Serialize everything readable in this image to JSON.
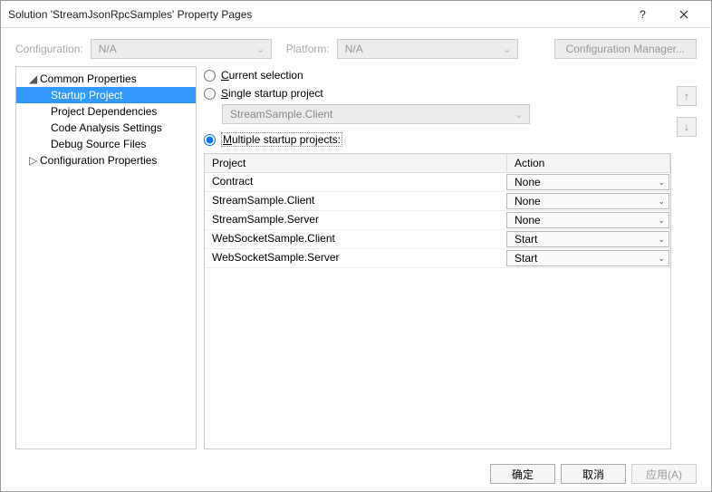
{
  "window": {
    "title": "Solution 'StreamJsonRpcSamples' Property Pages"
  },
  "configRow": {
    "configLabel_pre": "C",
    "configLabel_mid": "onfiguration:",
    "configValue": "N/A",
    "platformLabel_pre": "P",
    "platformLabel_mid": "latform:",
    "platformValue": "N/A",
    "managerLabel": "Configuration Manager..."
  },
  "tree": {
    "n0": "Common Properties",
    "n0_0": "Startup Project",
    "n0_1": "Project Dependencies",
    "n0_2": "Code Analysis Settings",
    "n0_3": "Debug Source Files",
    "n1": "Configuration Properties"
  },
  "radios": {
    "current_u": "C",
    "current_rest": "urrent selection",
    "single_u": "S",
    "single_rest": "ingle startup project",
    "singleValue": "StreamSample.Client",
    "multi_u": "M",
    "multi_rest": "ultiple startup projects:"
  },
  "grid": {
    "colProject": "Project",
    "colAction": "Action",
    "rows": {
      "0": {
        "p": "Contract",
        "a": "None"
      },
      "1": {
        "p": "StreamSample.Client",
        "a": "None"
      },
      "2": {
        "p": "StreamSample.Server",
        "a": "None"
      },
      "3": {
        "p": "WebSocketSample.Client",
        "a": "Start"
      },
      "4": {
        "p": "WebSocketSample.Server",
        "a": "Start"
      }
    }
  },
  "footer": {
    "ok": "确定",
    "cancel": "取消",
    "apply": "应用(A)"
  }
}
